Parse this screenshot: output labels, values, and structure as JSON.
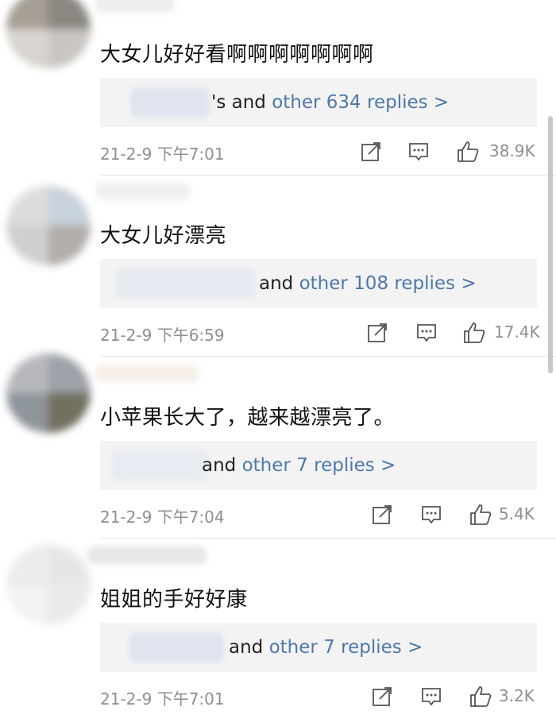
{
  "colors": {
    "link": "#4e79a8",
    "meta": "#8e8e93",
    "reply_bg": "#f3f3f4"
  },
  "comments": [
    {
      "text": "大女儿好好看啊啊啊啊啊啊啊",
      "reply_prefix": "'s and",
      "reply_link": "other 634 replies >",
      "time": "21-2-9 下午7:01",
      "likes": "38.9K",
      "avatar_colors": [
        "#a59f95",
        "#8a8881",
        "#d8d4cf",
        "#c9c5c1"
      ]
    },
    {
      "text": "大女儿好漂亮",
      "reply_prefix": "and",
      "reply_link": "other 108 replies >",
      "time": "21-2-9 下午6:59",
      "likes": "17.4K",
      "avatar_colors": [
        "#dcdcdc",
        "#c8d2dc",
        "#cfcfcf",
        "#b3adab"
      ]
    },
    {
      "text": "小苹果长大了，越来越漂亮了。",
      "reply_prefix": "and",
      "reply_link": "other 7 replies >",
      "time": "21-2-9 下午7:04",
      "likes": "5.4K",
      "avatar_colors": [
        "#b6b8bc",
        "#9ea2a8",
        "#8f959c",
        "#72705f"
      ]
    },
    {
      "text": "姐姐的手好好康",
      "reply_prefix": "and",
      "reply_link": "other 7 replies >",
      "time": "21-2-9 下午7:01",
      "likes": "3.2K",
      "avatar_colors": [
        "#ececec",
        "#e6e6e6",
        "#f2f2f2",
        "#eaeaea"
      ]
    }
  ],
  "icons": {
    "share": "share-icon",
    "comment": "comment-icon",
    "like": "like-icon"
  }
}
